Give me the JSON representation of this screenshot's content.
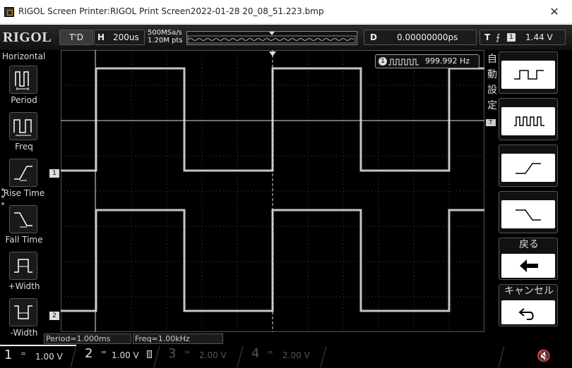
{
  "window": {
    "title": "RIGOL Screen Printer:RIGOL Print Screen2022-01-28 20_08_51.223.bmp",
    "close": "✕"
  },
  "scope": {
    "logo": "RIGOL",
    "run_mode": "T'D",
    "horizontal": {
      "label": "H",
      "timebase": "200us"
    },
    "acquisition": {
      "sample_rate": "500MSa/s",
      "memory": "1.20M pts"
    },
    "delay": {
      "label": "D",
      "value": "0.00000000ps"
    },
    "trigger": {
      "label": "T",
      "edge": "⨍",
      "channel": "1",
      "level": "1.44 V"
    },
    "left_menu": {
      "title": "Horizontal",
      "items": [
        {
          "label": "Period",
          "icon": "period-icon"
        },
        {
          "label": "Freq",
          "icon": "freq-icon"
        },
        {
          "label": "Rise Time",
          "icon": "rise-time-icon"
        },
        {
          "label": "Fall Time",
          "icon": "fall-time-icon"
        },
        {
          "label": "+Width",
          "icon": "positive-width-icon"
        },
        {
          "label": "-Width",
          "icon": "negative-width-icon"
        }
      ]
    },
    "right_menu": {
      "title": [
        "自",
        "動",
        "設",
        "定"
      ],
      "items": [
        {
          "label": "",
          "icon": "single-cycle-icon"
        },
        {
          "label": "",
          "icon": "multi-cycle-icon"
        },
        {
          "label": "",
          "icon": "rising-edge-icon"
        },
        {
          "label": "",
          "icon": "falling-edge-icon"
        },
        {
          "label": "戻る",
          "icon": "back-arrow-icon"
        },
        {
          "label": "キャンセル",
          "icon": "undo-icon"
        }
      ]
    },
    "measurement_readout": {
      "channel": "1",
      "value": "999.992 Hz"
    },
    "measurements": {
      "period": "Period=1.000ms",
      "freq": "Freq=1.00kHz"
    },
    "channels": [
      {
        "num": "1",
        "coupling": "═",
        "scale": "1.00 V",
        "active": true
      },
      {
        "num": "2",
        "coupling": "═",
        "scale": "1.00 V",
        "active": true
      },
      {
        "num": "3",
        "coupling": "═",
        "scale": "2.00 V",
        "active": false
      },
      {
        "num": "4",
        "coupling": "═",
        "scale": "2.00 V",
        "active": false
      }
    ],
    "channel_markers": {
      "ch1": "1",
      "ch2": "2",
      "trigger": "T"
    },
    "colors": {
      "trace": "#e8e8e8",
      "grid": "#444444",
      "background": "#000000"
    },
    "waveform": {
      "type": "square",
      "ch1_frequency_hz": 1000,
      "ch2_frequency_hz": 1000,
      "duty_percent": 50
    }
  }
}
